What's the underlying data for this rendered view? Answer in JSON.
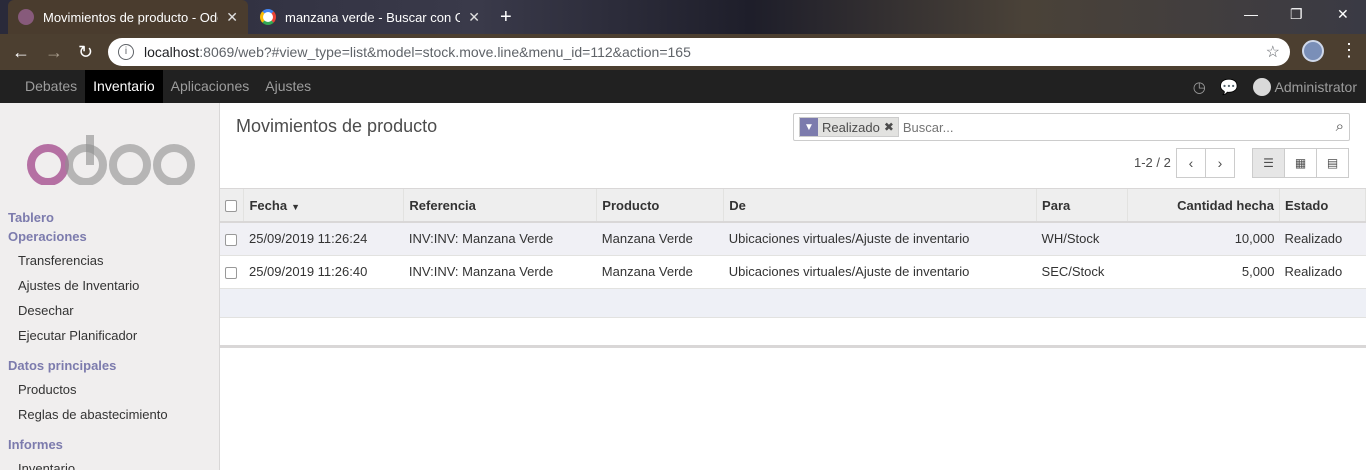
{
  "browser": {
    "tabs": [
      {
        "title": "Movimientos de producto - Odoo",
        "active": true
      },
      {
        "title": "manzana verde - Buscar con Google",
        "active": false
      }
    ],
    "url_host": "localhost",
    "url_rest": ":8069/web?#view_type=list&model=stock.move.line&menu_id=112&action=165"
  },
  "topnav": {
    "menu": [
      "Debates",
      "Inventario",
      "Aplicaciones",
      "Ajustes"
    ],
    "active_menu": "Inventario",
    "user": "Administrator"
  },
  "sidebar": {
    "sections": [
      {
        "label": "Tablero"
      },
      {
        "label": "Operaciones",
        "items": [
          "Transferencias",
          "Ajustes de Inventario",
          "Desechar",
          "Ejecutar Planificador"
        ]
      },
      {
        "label": "Datos principales",
        "items": [
          "Productos",
          "Reglas de abastecimiento"
        ]
      },
      {
        "label": "Informes",
        "items": [
          "Inventario"
        ]
      }
    ]
  },
  "control_panel": {
    "title": "Movimientos de producto",
    "facet": "Realizado",
    "search_placeholder": "Buscar...",
    "pager": "1-2 / 2"
  },
  "table": {
    "columns": [
      "Fecha",
      "Referencia",
      "Producto",
      "De",
      "Para",
      "Cantidad hecha",
      "Estado"
    ],
    "rows": [
      [
        "25/09/2019 11:26:24",
        "INV:INV: Manzana Verde",
        "Manzana Verde",
        "Ubicaciones virtuales/Ajuste de inventario",
        "WH/Stock",
        "10,000",
        "Realizado"
      ],
      [
        "25/09/2019 11:26:40",
        "INV:INV: Manzana Verde",
        "Manzana Verde",
        "Ubicaciones virtuales/Ajuste de inventario",
        "SEC/Stock",
        "5,000",
        "Realizado"
      ]
    ]
  },
  "colors": {
    "brand": "#7c7bad",
    "logo_o": "#a24689",
    "logo_grey": "#8f8f8f"
  }
}
